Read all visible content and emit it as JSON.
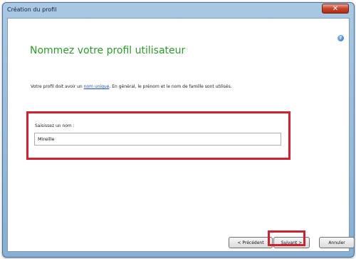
{
  "window": {
    "title": "Création du profil",
    "close_symbol": "✕"
  },
  "help": {
    "symbol": "?"
  },
  "heading": "Nommez votre profil utilisateur",
  "description": {
    "prefix": "Votre profil doit avoir un ",
    "link": "nom unique",
    "suffix": ". En général, le prénom et le nom de famille sont utilisés."
  },
  "name_field": {
    "label": "Saisissez un nom :",
    "value": "Mireille"
  },
  "buttons": {
    "previous": "< Précédent",
    "next": "Suivant >",
    "cancel": "Annuler"
  },
  "colors": {
    "heading": "#2a9a2a",
    "highlight": "#d1202f",
    "link": "#1a4fb8"
  },
  "icons": {
    "close": "close-icon",
    "help": "help-icon"
  }
}
